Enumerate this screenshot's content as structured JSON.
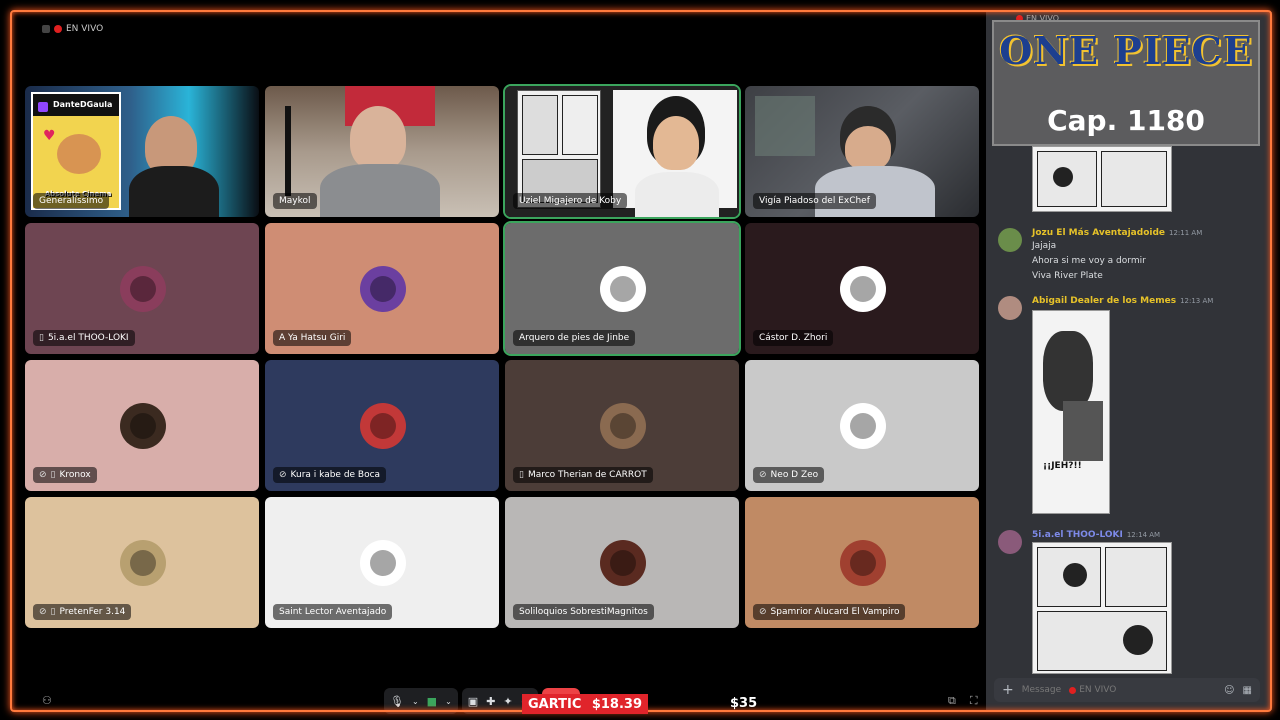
{
  "stream": {
    "live_label": "EN VIVO"
  },
  "overlay": {
    "show_title": "ONE PIECE",
    "chapter": "Cap. 1180",
    "ticker_name": "GARTIC",
    "ticker_price": "$18.39",
    "ticker_price2": "$35"
  },
  "video_tiles": [
    {
      "name": "Generalíssimo",
      "overlay_tag": "DanteDGaula",
      "overlay_brand": "Absolute Cinema"
    },
    {
      "name": "Maykol"
    },
    {
      "name": "Uziel Migajero de Koby"
    },
    {
      "name": "Vigía Piadoso del ExChef"
    }
  ],
  "avatar_tiles": [
    {
      "name": "5i.a.el THOO-LOKI",
      "icons": "mobile"
    },
    {
      "name": "A Ya Hatsu Giri",
      "icons": ""
    },
    {
      "name": "Arquero de pies de Jinbe",
      "icons": ""
    },
    {
      "name": "Cástor D. Zhori",
      "icons": ""
    },
    {
      "name": "Kronox",
      "icons": "muted-mobile"
    },
    {
      "name": "Kura i kabe de Boca",
      "icons": "muted"
    },
    {
      "name": "Marco Therian de CARROT",
      "icons": "mobile"
    },
    {
      "name": "Neo D Zeo",
      "icons": "muted"
    },
    {
      "name": "PretenFer 3.14",
      "icons": "muted-mobile"
    },
    {
      "name": "Saint Lector Aventajado",
      "icons": ""
    },
    {
      "name": "Soliloquios SobrestiMagnitos",
      "icons": ""
    },
    {
      "name": "Spamrior Alucard El Vampiro",
      "icons": "muted"
    }
  ],
  "colors": {
    "tile_bgs": [
      "#6e4552",
      "#cf8d74",
      "#6c6c6c",
      "#2a1a1d",
      "#d8aeaa",
      "#2e3a5e",
      "#4c3d38",
      "#c9c9c9",
      "#ddc29d",
      "#efefef",
      "#b9b7b6",
      "#c08a64"
    ],
    "accent_border": "#ff7a3d",
    "speaking": "#3ba55d",
    "end_call": "#ed4245"
  },
  "chat": {
    "messages": [
      {
        "author": "Jozu El Más Aventajadoide",
        "time": "12:11 AM",
        "author_color": "#e6c229",
        "lines": [
          "Jajaja",
          "Ahora si me voy a dormir",
          "Viva River Plate"
        ]
      },
      {
        "author": "Abigail Dealer de los Memes",
        "time": "12:13 AM",
        "author_color": "#e6c229",
        "lines": [],
        "image_caption": "¡¡JEH?!!"
      },
      {
        "author": "5i.a.el THOO-LOKI",
        "time": "12:14 AM",
        "author_color": "#7d8ae8",
        "lines": []
      }
    ],
    "input_placeholder": "Message",
    "input_channel": "EN VIVO"
  },
  "controls": {
    "mic_icon": "microphone-icon",
    "camera_icon": "camera-icon",
    "screenshare_icon": "screen-share-icon",
    "activities_icon": "activities-icon",
    "soundboard_icon": "soundboard-icon",
    "more_icon": "more-icon",
    "end_icon": "end-call-icon"
  }
}
